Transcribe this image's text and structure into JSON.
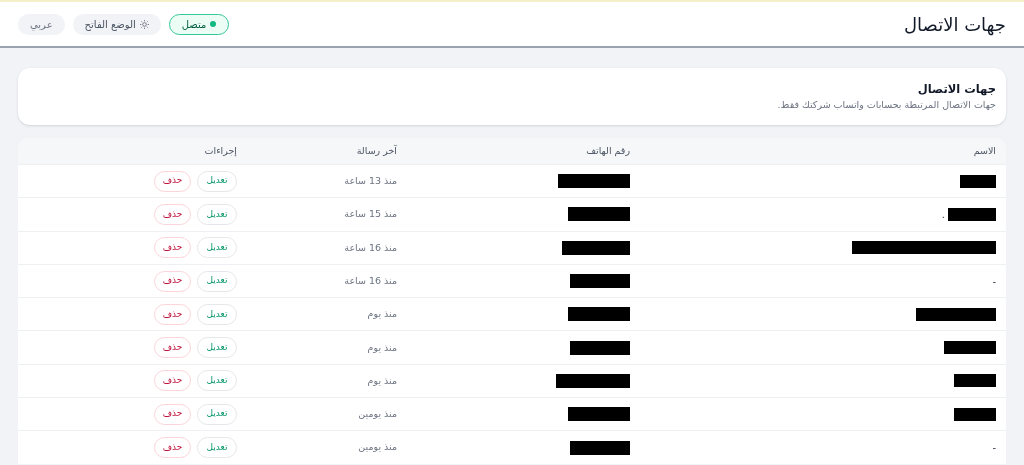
{
  "header": {
    "title": "جهات الاتصال",
    "status": {
      "label": "متصل",
      "connected": true
    },
    "theme_button": "الوضع الفاتح",
    "language_button": "عربي"
  },
  "intro_card": {
    "title": "جهات الاتصال",
    "description": "جهات الاتصال المرتبطة بحسابات واتساب شركتك فقط."
  },
  "table": {
    "columns": [
      "الاسم",
      "رقم الهاتف",
      "آخر رسالة",
      "إجراءات"
    ],
    "rows": [
      {
        "name": {
          "kind": "redacted"
        },
        "phone": {
          "kind": "redacted"
        },
        "last_message": "منذ 13 ساعة",
        "edit": "تعديل",
        "delete": "حذف"
      },
      {
        "name": {
          "kind": "redacted",
          "text": "."
        },
        "phone": {
          "kind": "redacted"
        },
        "last_message": "منذ 15 ساعة",
        "edit": "تعديل",
        "delete": "حذف"
      },
      {
        "name": {
          "kind": "redacted"
        },
        "phone": {
          "kind": "redacted"
        },
        "last_message": "منذ 16 ساعة",
        "edit": "تعديل",
        "delete": "حذف"
      },
      {
        "name": {
          "kind": "text",
          "text": "-"
        },
        "phone": {
          "kind": "redacted"
        },
        "last_message": "منذ 16 ساعة",
        "edit": "تعديل",
        "delete": "حذف"
      },
      {
        "name": {
          "kind": "redacted"
        },
        "phone": {
          "kind": "redacted"
        },
        "last_message": "منذ يوم",
        "edit": "تعديل",
        "delete": "حذف"
      },
      {
        "name": {
          "kind": "redacted"
        },
        "phone": {
          "kind": "redacted"
        },
        "last_message": "منذ يوم",
        "edit": "تعديل",
        "delete": "حذف"
      },
      {
        "name": {
          "kind": "redacted"
        },
        "phone": {
          "kind": "redacted"
        },
        "last_message": "منذ يوم",
        "edit": "تعديل",
        "delete": "حذف"
      },
      {
        "name": {
          "kind": "redacted"
        },
        "phone": {
          "kind": "redacted"
        },
        "last_message": "منذ يومين",
        "edit": "تعديل",
        "delete": "حذف"
      },
      {
        "name": {
          "kind": "text",
          "text": "-"
        },
        "phone": {
          "kind": "redacted"
        },
        "last_message": "منذ يومين",
        "edit": "تعديل",
        "delete": "حذف"
      }
    ]
  }
}
